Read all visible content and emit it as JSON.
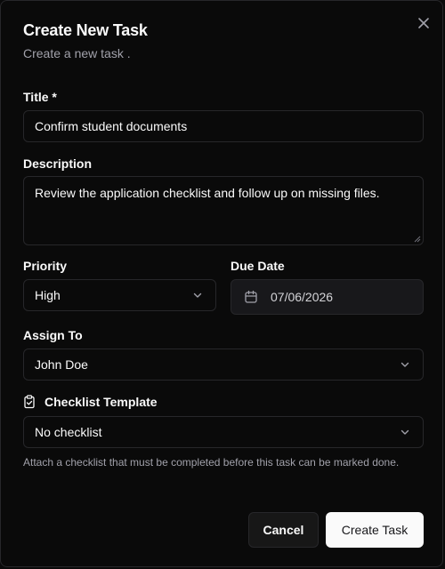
{
  "dialog": {
    "title": "Create New Task",
    "subtitle": "Create a new task ."
  },
  "form": {
    "title_label": "Title *",
    "title_value": "Confirm student documents",
    "description_label": "Description",
    "description_value": "Review the application checklist and follow up on missing files.",
    "priority_label": "Priority",
    "priority_value": "High",
    "due_date_label": "Due Date",
    "due_date_value": "07/06/2026",
    "assign_to_label": "Assign To",
    "assign_to_value": "John Doe",
    "checklist_label": "Checklist Template",
    "checklist_value": "No checklist",
    "checklist_hint": "Attach a checklist that must be completed before this task can be marked done."
  },
  "actions": {
    "cancel_label": "Cancel",
    "submit_label": "Create Task"
  },
  "icons": {
    "close": "close-icon",
    "chevron": "chevron-down-icon",
    "calendar": "calendar-icon",
    "clipboard": "clipboard-check-icon"
  },
  "colors": {
    "background": "#0a0a0a",
    "border": "#27272a",
    "muted_text": "#a1a1aa",
    "primary_button": "#fafafa"
  }
}
